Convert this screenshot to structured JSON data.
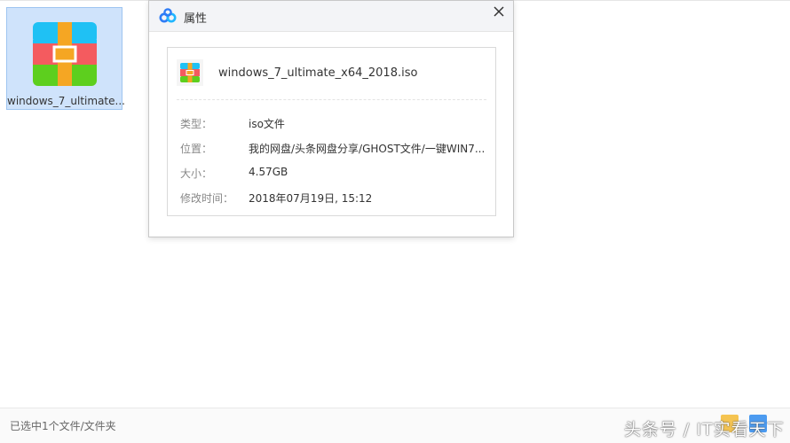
{
  "desktop": {
    "file_name": "windows_7_ultimate...",
    "icon": "winrar-archive-icon"
  },
  "dialog": {
    "logo": "baidu-netdisk-logo-icon",
    "title": "属性",
    "close_icon": "close-icon",
    "file_icon": "winrar-archive-icon",
    "file_name": "windows_7_ultimate_x64_2018.iso",
    "properties": [
      {
        "label": "类型：",
        "value": "iso文件"
      },
      {
        "label": "位置：",
        "value": "我的网盘/头条网盘分享/GHOST文件/一键WIN7..."
      },
      {
        "label": "大小：",
        "value": "4.57GB"
      },
      {
        "label": "修改时间：",
        "value": "2018年07月19日, 15:12"
      }
    ]
  },
  "statusbar": {
    "text": "已选中1个文件/文件夹"
  },
  "watermark": "头条号 / IT实看天下",
  "colors": {
    "selection": "#cfe3fb",
    "icon_cyan": "#1fc1f4",
    "icon_red": "#f45b5f",
    "icon_green": "#5dcf1e",
    "icon_orange": "#f5a623"
  }
}
